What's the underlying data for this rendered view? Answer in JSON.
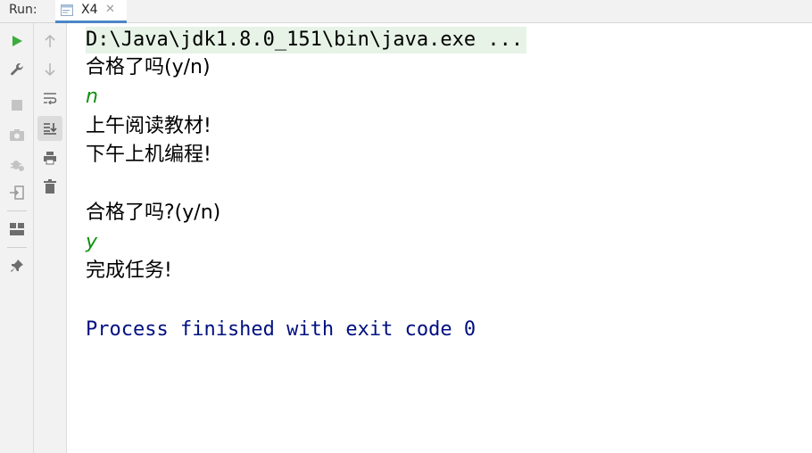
{
  "header": {
    "run_label": "Run:",
    "tab_title": "X4"
  },
  "toolbar_left": [
    "rerun-icon",
    "wrench-icon",
    "stop-icon",
    "camera-icon",
    "debug-icon",
    "login-icon",
    "layout-icon",
    "pin-icon"
  ],
  "toolbar_second": [
    "up-arrow-icon",
    "down-arrow-icon",
    "soft-wrap-icon",
    "scroll-to-end-icon",
    "print-icon",
    "trash-icon"
  ],
  "console": {
    "lines": [
      "D:\\Java\\jdk1.8.0_151\\bin\\java.exe ...",
      "合格了吗(y/n)",
      "n",
      "上午阅读教材!",
      "下午上机编程!",
      "",
      "合格了吗?(y/n)",
      "y",
      "完成任务!",
      "",
      "Process finished with exit code 0"
    ]
  },
  "colors": {
    "input": "#109010",
    "system": "#001080",
    "run": "#3cac3c",
    "tab_underline": "#4c86c6"
  }
}
